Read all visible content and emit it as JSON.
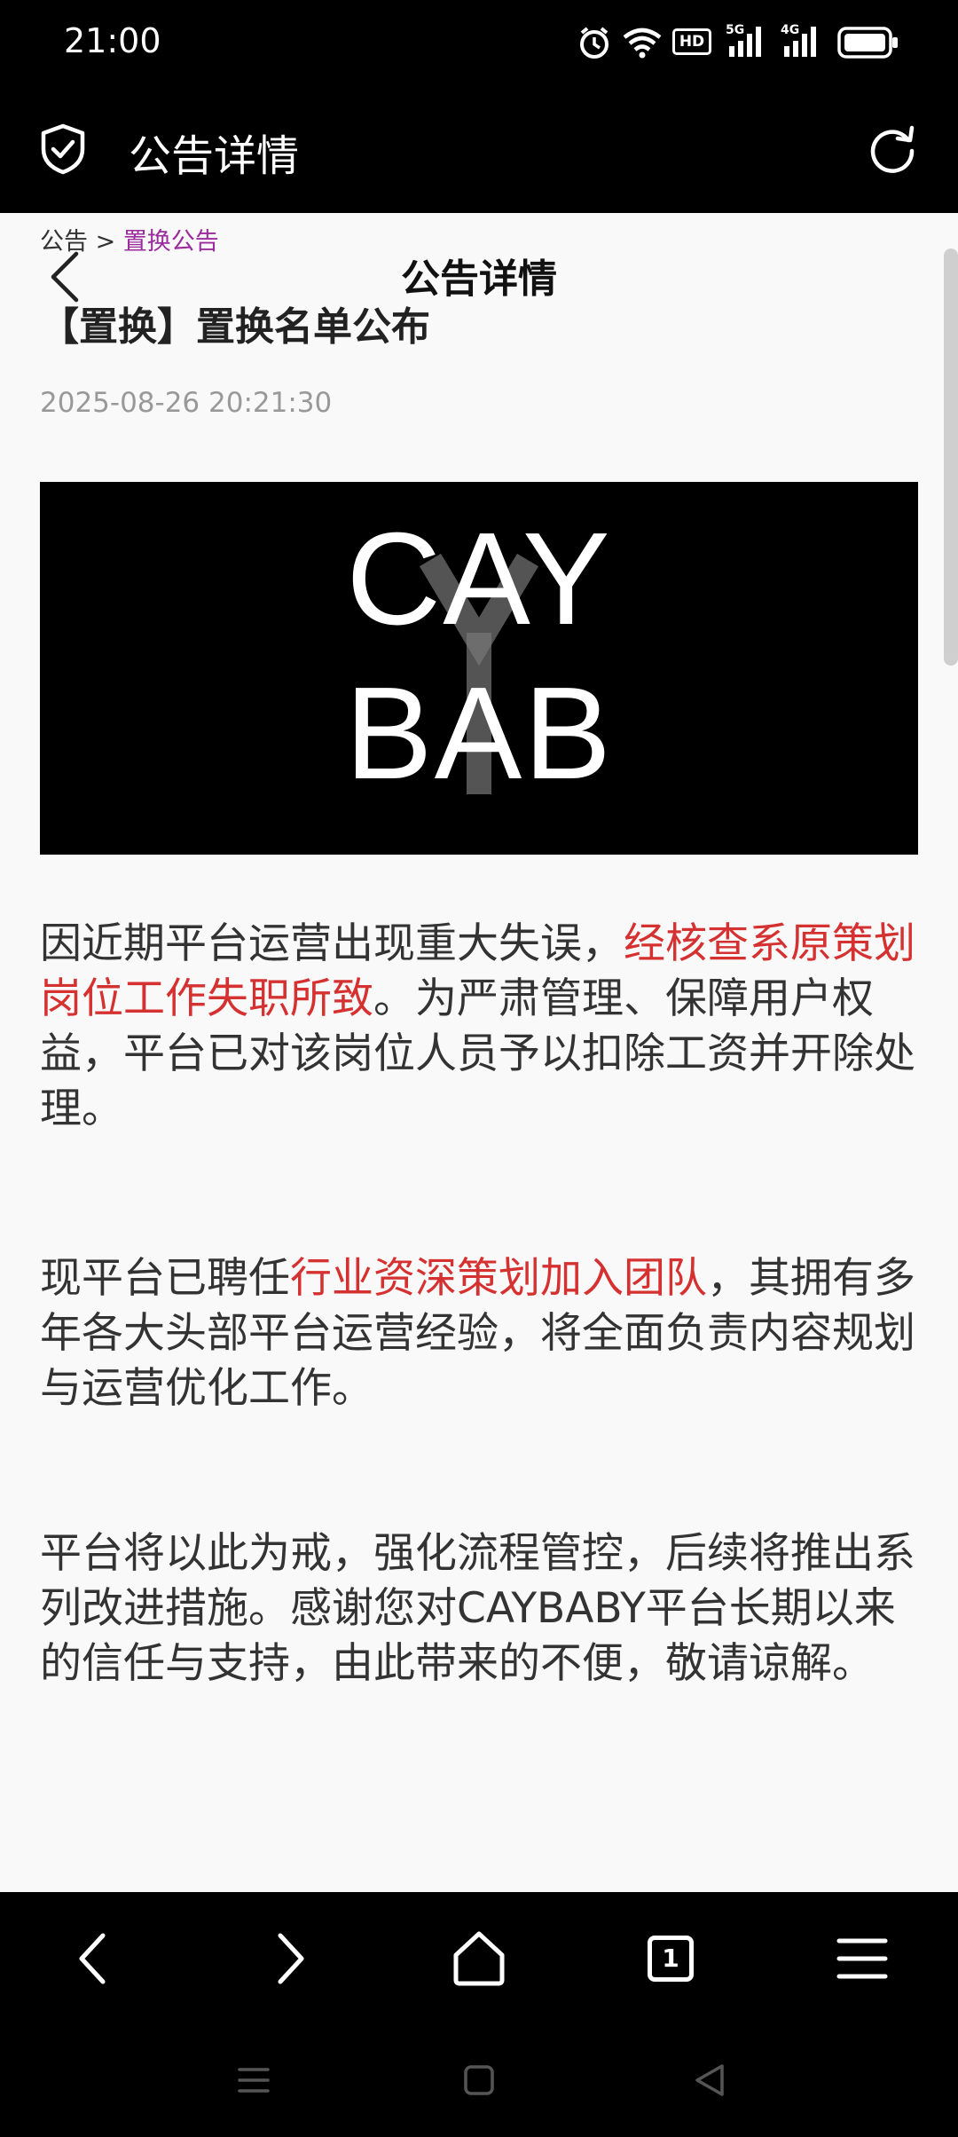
{
  "status_bar": {
    "time": "21:00",
    "icons": [
      "alarm-icon",
      "wifi-icon",
      "hd-icon",
      "5g-signal-icon",
      "4g-signal-icon",
      "battery-icon"
    ],
    "hd_label": "HD",
    "net1_label": "5G",
    "net2_label": "4G"
  },
  "browser_bar": {
    "title": "公告详情",
    "icons": [
      "shield-check-icon",
      "refresh-icon"
    ]
  },
  "page": {
    "breadcrumb": {
      "parent": "公告",
      "separator": ">",
      "current": "置换公告"
    },
    "header_title": "公告详情",
    "article": {
      "title": "【置换】置换名单公布",
      "date": "2025-08-26 20:21:30",
      "banner_logo": "CAYBABY",
      "paragraphs": [
        {
          "before": "因近期平台运营出现重大失误，",
          "highlight": "经核查系原策划岗位工作失职所致",
          "after": "。为严肃管理、保障用户权益，平台已对该岗位人员予以扣除工资并开除处理。"
        },
        {
          "before": "现平台已聘任",
          "highlight": "行业资深策划加入团队",
          "after": "，其拥有多年各大头部平台运营经验，将全面负责内容规划与运营优化工作。"
        },
        {
          "before": "平台将以此为戒，强化流程管控，后续将推出系列改进措施。感谢您对CAYBABY平台长期以来的信任与支持，由此带来的不便，敬请谅解。",
          "highlight": "",
          "after": ""
        }
      ]
    }
  },
  "bottom_nav": {
    "icons": [
      "back-icon",
      "forward-icon",
      "home-icon",
      "tabs-icon",
      "menu-icon"
    ],
    "tab_count": "1"
  },
  "system_nav": {
    "icons": [
      "recents-icon",
      "home-square-icon",
      "back-triangle-icon"
    ]
  },
  "colors": {
    "highlight": "#d63131",
    "breadcrumb_current": "#9b2c9e",
    "background": "#f9f9f9"
  }
}
